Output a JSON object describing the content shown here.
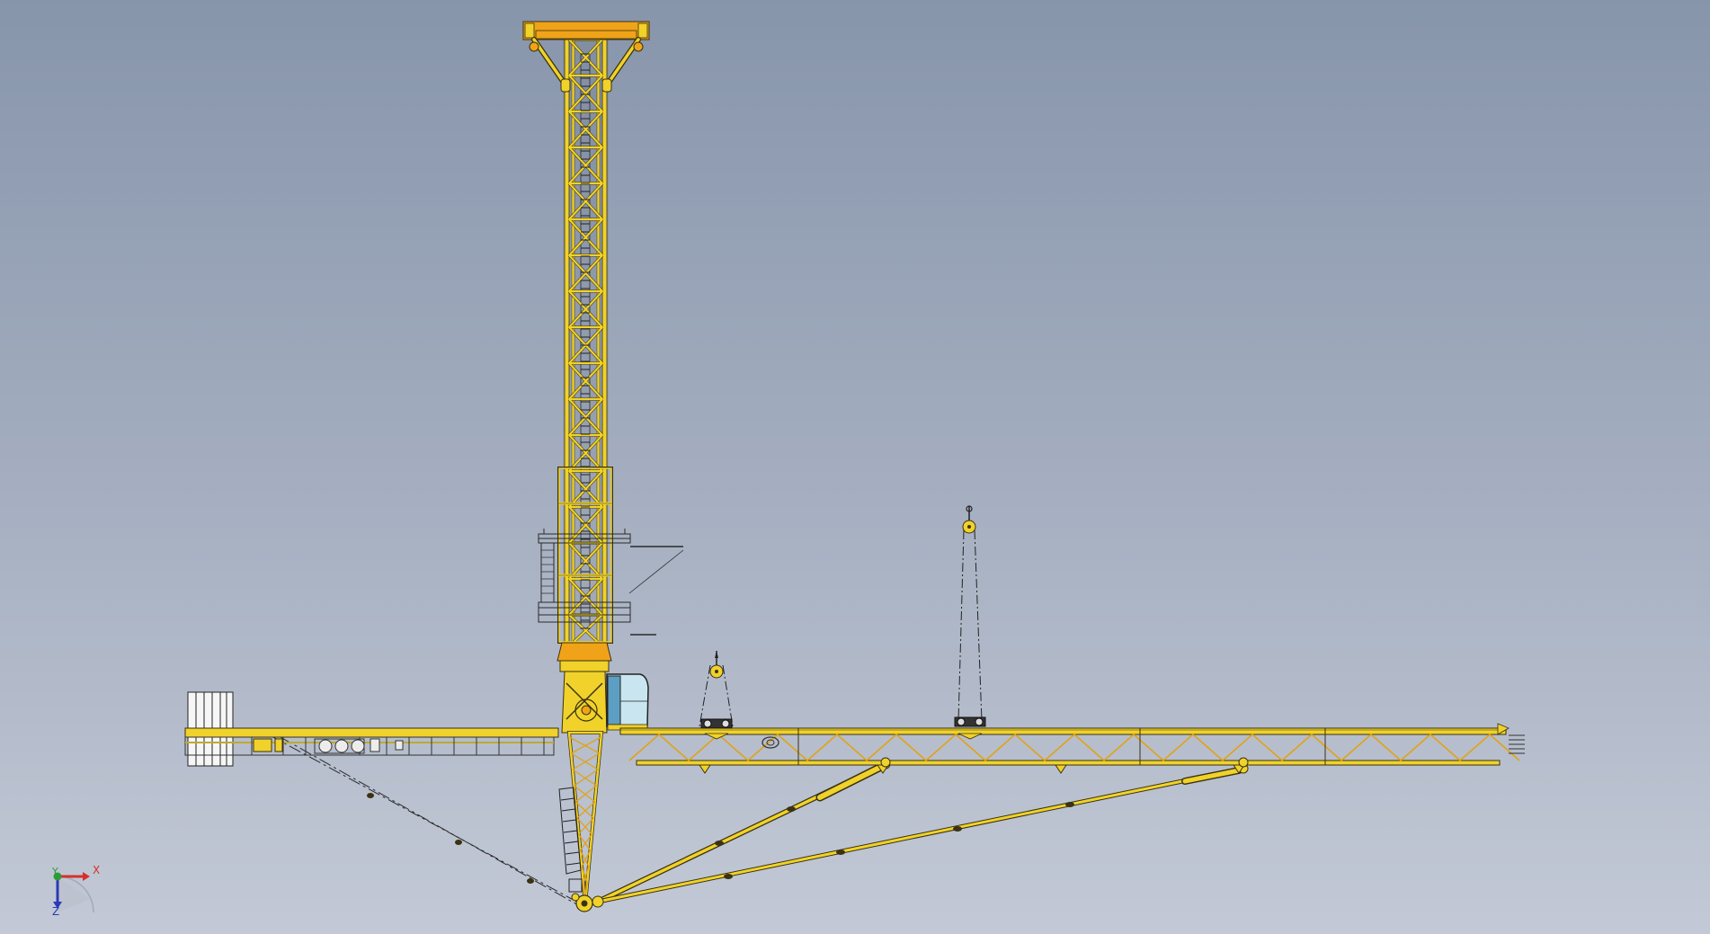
{
  "viewport": {
    "background_top": "#8795ab",
    "background_bottom": "#c3c9d6"
  },
  "model": {
    "primary_color": "#f0d22a",
    "head_color": "#f0a319",
    "edge_color": "#3a3210",
    "cab_color": "#c9e6f0",
    "steel_color": "#222222"
  },
  "triad": {
    "x_label": "X",
    "y_label": "Y",
    "z_label": "Z",
    "x_color": "#d4312b",
    "y_color": "#2d9b3a",
    "z_color": "#2b39b8"
  }
}
